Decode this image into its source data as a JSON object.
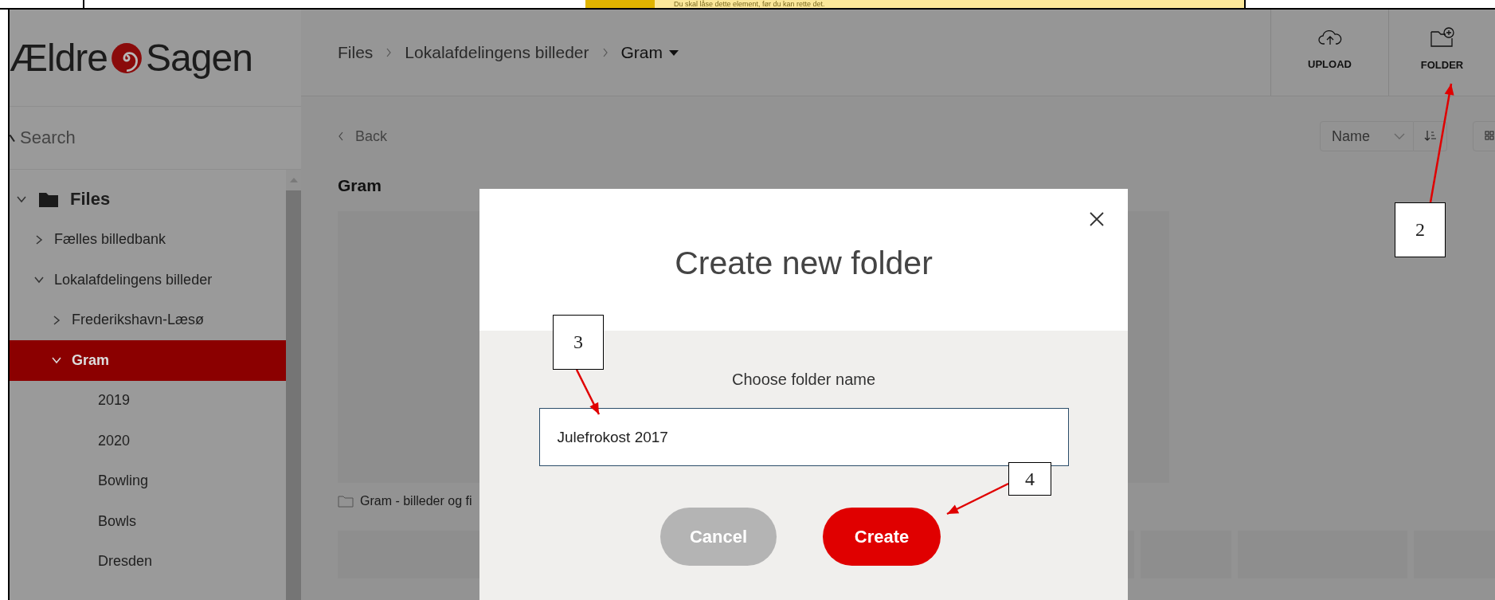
{
  "notice": {
    "text": "Du skal låse dette element, før du kan rette det."
  },
  "logo": {
    "left": "Ældre",
    "right": "Sagen"
  },
  "search": {
    "placeholder": "Search"
  },
  "tree": [
    {
      "label": "Files",
      "kind": "root",
      "expanded": true,
      "selected": false,
      "children": [
        {
          "label": "Fælles billedbank",
          "kind": "folder",
          "expanded": false,
          "selected": false
        },
        {
          "label": "Lokalafdelingens billeder",
          "kind": "folder",
          "expanded": true,
          "selected": false,
          "children": [
            {
              "label": "Frederikshavn-Læsø",
              "kind": "folder",
              "expanded": false,
              "selected": false
            },
            {
              "label": "Gram",
              "kind": "folder",
              "expanded": true,
              "selected": true,
              "children": [
                {
                  "label": "2019",
                  "kind": "leaf",
                  "selected": false
                },
                {
                  "label": "2020",
                  "kind": "leaf",
                  "selected": false
                },
                {
                  "label": "Bowling",
                  "kind": "leaf",
                  "selected": false
                },
                {
                  "label": "Bowls",
                  "kind": "leaf",
                  "selected": false
                },
                {
                  "label": "Dresden",
                  "kind": "leaf",
                  "selected": false
                }
              ]
            }
          ]
        }
      ]
    }
  ],
  "breadcrumb": [
    "Files",
    "Lokalafdelingens billeder",
    "Gram"
  ],
  "toolbar": [
    {
      "label": "UPLOAD",
      "kind": "upload"
    },
    {
      "label": "FOLDER",
      "kind": "folder"
    }
  ],
  "back": "Back",
  "sort": {
    "value": "Name"
  },
  "heading": "Gram",
  "tiles": [
    {
      "caption": "Gram - billeder og fi"
    }
  ],
  "dialog": {
    "title": "Create new folder",
    "label": "Choose folder name",
    "value": "Julefrokost 2017",
    "buttons": [
      {
        "label": "Cancel",
        "kind": "secondary",
        "disabled": true
      },
      {
        "label": "Create",
        "kind": "primary",
        "disabled": false
      }
    ]
  },
  "annotations": [
    {
      "label": "2"
    },
    {
      "label": "3"
    },
    {
      "label": "4"
    }
  ]
}
